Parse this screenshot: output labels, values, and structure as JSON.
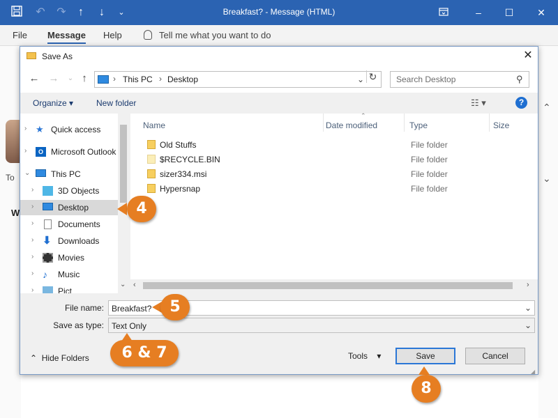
{
  "window": {
    "title": "Breakfast? - Message (HTML)"
  },
  "ribbon": {
    "tabs": [
      "File",
      "Message",
      "Help"
    ],
    "tell_me": "Tell me what you want to do"
  },
  "behind": {
    "to_label": "To",
    "w_label": "W"
  },
  "dialog": {
    "title": "Save As",
    "address": {
      "crumbs": [
        "This PC",
        "Desktop"
      ]
    },
    "search_placeholder": "Search Desktop",
    "toolbar": {
      "organize": "Organize",
      "new_folder": "New folder"
    },
    "nav_items": [
      {
        "label": "Quick access",
        "icon": "star-icon"
      },
      {
        "label": "Microsoft Outlook",
        "icon": "outlook-icon"
      },
      {
        "label": "This PC",
        "icon": "pc-icon"
      },
      {
        "label": "3D Objects",
        "icon": "cube-icon"
      },
      {
        "label": "Desktop",
        "icon": "desktop-icon",
        "selected": true
      },
      {
        "label": "Documents",
        "icon": "document-icon"
      },
      {
        "label": "Downloads",
        "icon": "download-icon"
      },
      {
        "label": "Movies",
        "icon": "movie-icon"
      },
      {
        "label": "Music",
        "icon": "music-icon"
      },
      {
        "label": "Pict",
        "icon": "picture-icon"
      }
    ],
    "columns": [
      "Name",
      "Date modified",
      "Type",
      "Size"
    ],
    "files": [
      {
        "name": "Old Stuffs",
        "type": "File folder"
      },
      {
        "name": "$RECYCLE.BIN",
        "type": "File folder"
      },
      {
        "name": "sizer334.msi",
        "type": "File folder"
      },
      {
        "name": "Hypersnap",
        "type": "File folder"
      }
    ],
    "file_name_label": "File name:",
    "file_name_value": "Breakfast?",
    "save_type_label": "Save as type:",
    "save_type_value": "Text Only",
    "hide_folders": "Hide Folders",
    "tools": "Tools",
    "save": "Save",
    "cancel": "Cancel"
  },
  "callouts": {
    "c4": "4",
    "c5": "5",
    "c67": "6 & 7",
    "c8": "8"
  },
  "colors": {
    "accent": "#2b63b2",
    "callout": "#e67e22"
  }
}
